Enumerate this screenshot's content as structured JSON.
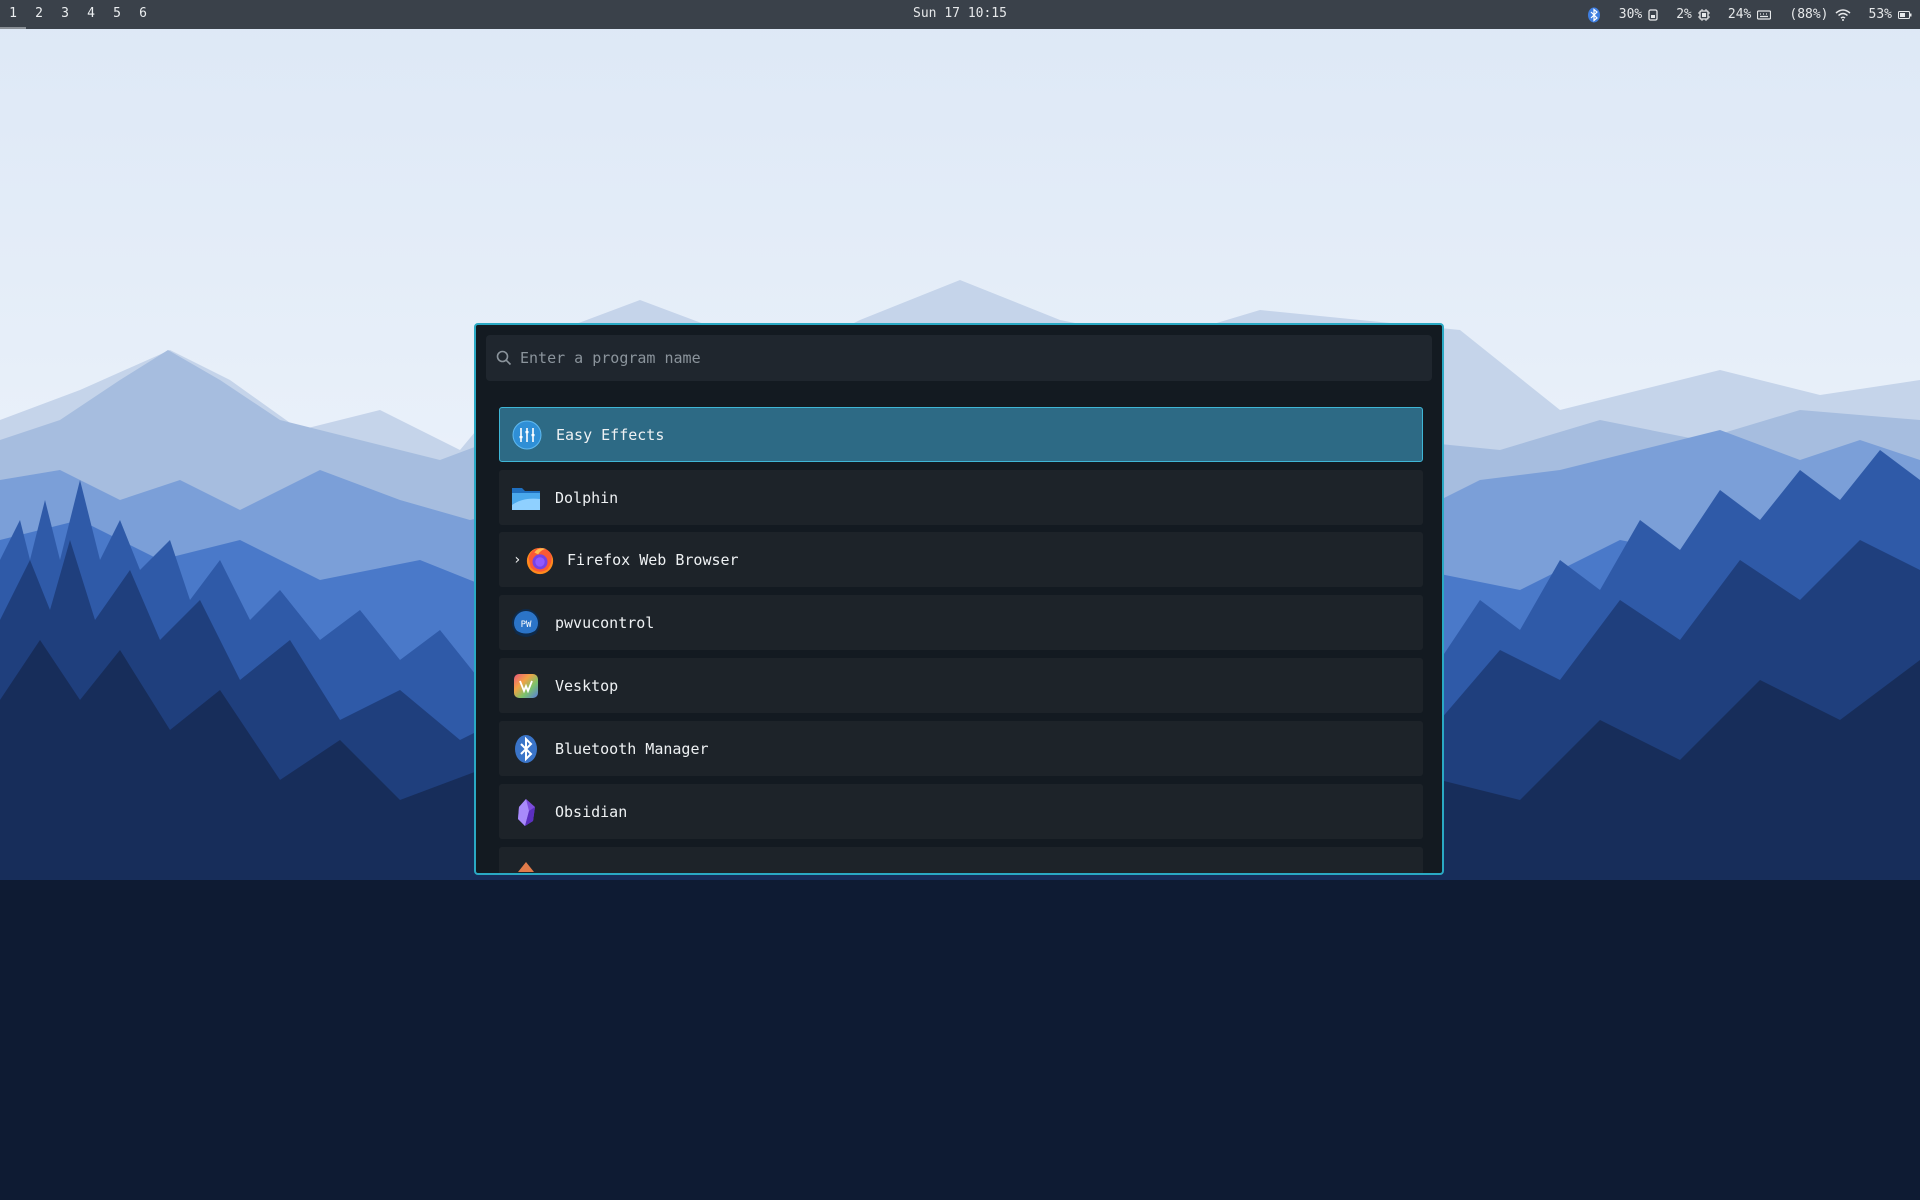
{
  "topbar": {
    "workspaces": [
      "1",
      "2",
      "3",
      "4",
      "5",
      "6"
    ],
    "active_workspace": "1",
    "clock": "Sun 17 10:15",
    "status": {
      "cpu": "30%",
      "memory": "2%",
      "disk": "24%",
      "wifi": "(88%)",
      "battery": "53%"
    }
  },
  "launcher": {
    "search_placeholder": "Enter a program name",
    "search_value": "",
    "items": [
      {
        "label": "Easy Effects",
        "icon": "easy-effects-icon",
        "selected": true
      },
      {
        "label": "Dolphin",
        "icon": "dolphin-folder-icon",
        "selected": false
      },
      {
        "label": "Firefox Web Browser",
        "icon": "firefox-icon",
        "selected": false,
        "expandable": true
      },
      {
        "label": "pwvucontrol",
        "icon": "pwvucontrol-icon",
        "selected": false
      },
      {
        "label": "Vesktop",
        "icon": "vesktop-icon",
        "selected": false
      },
      {
        "label": "Bluetooth Manager",
        "icon": "bluetooth-icon",
        "selected": false
      },
      {
        "label": "Obsidian",
        "icon": "obsidian-icon",
        "selected": false
      }
    ]
  },
  "colors": {
    "accent": "#2aa9c4",
    "selected_bg": "#2d6a85",
    "launcher_bg": "#131a21",
    "item_bg": "#1d2329",
    "topbar_bg": "#3a414a"
  }
}
